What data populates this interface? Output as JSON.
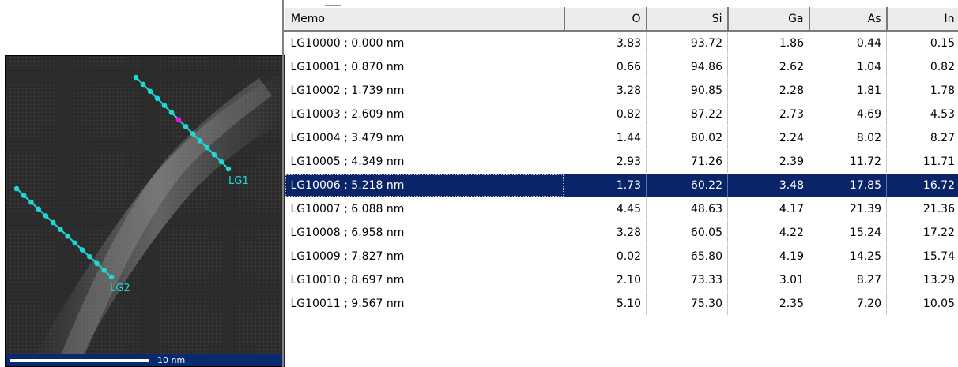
{
  "image": {
    "line_labels": [
      "LG1",
      "LG2"
    ],
    "scalebar_label": "10 nm",
    "colors": {
      "line": "#1fd7d7",
      "marker": "#e01ad6",
      "scalebar_bg": "#0a2a70"
    }
  },
  "table": {
    "columns": [
      "Memo",
      "O",
      "Si",
      "Ga",
      "As",
      "In"
    ],
    "selected_row": 6,
    "rows": [
      [
        "LG10000 ; 0.000 nm",
        "3.83",
        "93.72",
        "1.86",
        "0.44",
        "0.15"
      ],
      [
        "LG10001 ; 0.870 nm",
        "0.66",
        "94.86",
        "2.62",
        "1.04",
        "0.82"
      ],
      [
        "LG10002 ; 1.739 nm",
        "3.28",
        "90.85",
        "2.28",
        "1.81",
        "1.78"
      ],
      [
        "LG10003 ; 2.609 nm",
        "0.82",
        "87.22",
        "2.73",
        "4.69",
        "4.53"
      ],
      [
        "LG10004 ; 3.479 nm",
        "1.44",
        "80.02",
        "2.24",
        "8.02",
        "8.27"
      ],
      [
        "LG10005 ; 4.349 nm",
        "2.93",
        "71.26",
        "2.39",
        "11.72",
        "11.71"
      ],
      [
        "LG10006 ; 5.218 nm",
        "1.73",
        "60.22",
        "3.48",
        "17.85",
        "16.72"
      ],
      [
        "LG10007 ; 6.088 nm",
        "4.45",
        "48.63",
        "4.17",
        "21.39",
        "21.36"
      ],
      [
        "LG10008 ; 6.958 nm",
        "3.28",
        "60.05",
        "4.22",
        "15.24",
        "17.22"
      ],
      [
        "LG10009 ; 7.827 nm",
        "0.02",
        "65.80",
        "4.19",
        "14.25",
        "15.74"
      ],
      [
        "LG10010 ; 8.697 nm",
        "2.10",
        "73.33",
        "3.01",
        "8.27",
        "13.29"
      ],
      [
        "LG10011 ; 9.567 nm",
        "5.10",
        "75.30",
        "2.35",
        "7.20",
        "10.05"
      ]
    ]
  }
}
